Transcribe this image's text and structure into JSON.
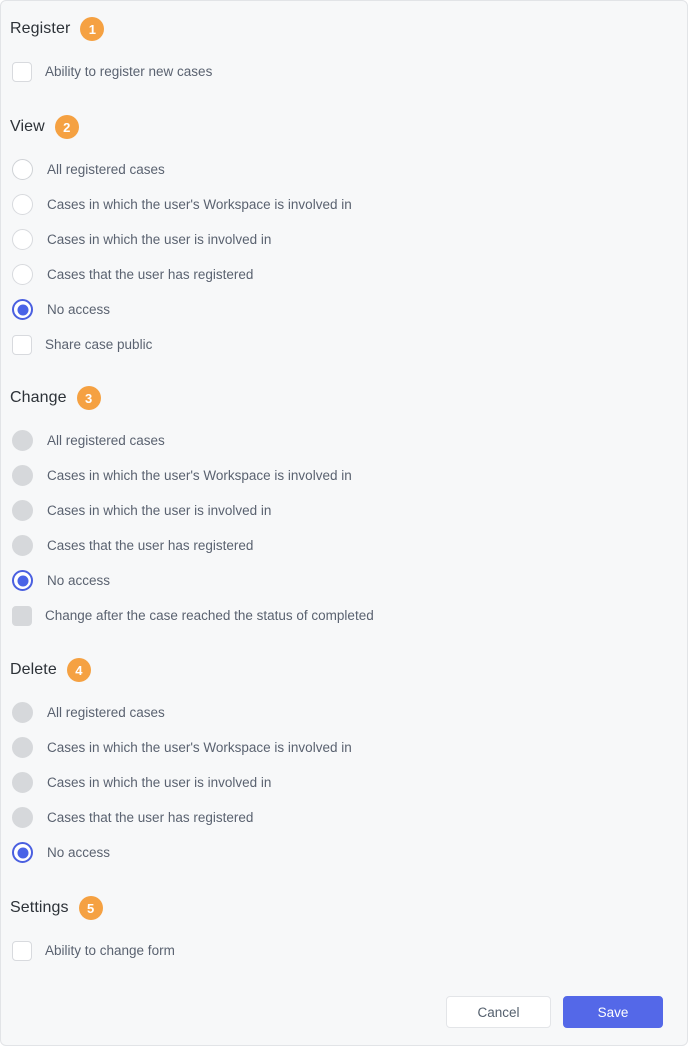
{
  "colors": {
    "card_background": "#f7f8f9",
    "card_border": "#e2e4e7",
    "badge_orange": "#f5a142",
    "accent_blue": "#5468e8",
    "radio_selected_blue": "#4a63e7",
    "disabled_gray": "#d6d8db",
    "heading_text": "#2d3238",
    "label_text": "#5a6270"
  },
  "sections": [
    {
      "key": "register",
      "title": "Register",
      "badge": "1",
      "options": [
        {
          "type": "checkbox",
          "label": "Ability to register new cases",
          "state": "unchecked",
          "name": "checkbox-ability-to-register-new-cases"
        }
      ]
    },
    {
      "key": "view",
      "title": "View",
      "badge": "2",
      "options": [
        {
          "type": "radio",
          "label": "All registered cases",
          "state": "unselected",
          "name": "radio-view-all-registered-cases"
        },
        {
          "type": "radio",
          "label": "Cases in which the user's Workspace is involved in",
          "state": "unselected",
          "name": "radio-view-workspace-involved"
        },
        {
          "type": "radio",
          "label": "Cases in which the user is involved in",
          "state": "unselected",
          "name": "radio-view-user-involved"
        },
        {
          "type": "radio",
          "label": "Cases that the user has registered",
          "state": "unselected",
          "name": "radio-view-user-registered"
        },
        {
          "type": "radio",
          "label": "No access",
          "state": "selected",
          "name": "radio-view-no-access"
        },
        {
          "type": "checkbox",
          "label": "Share case public",
          "state": "unchecked",
          "name": "checkbox-share-case-public"
        }
      ]
    },
    {
      "key": "change",
      "title": "Change",
      "badge": "3",
      "options": [
        {
          "type": "radio",
          "label": "All registered cases",
          "state": "disabled",
          "name": "radio-change-all-registered-cases"
        },
        {
          "type": "radio",
          "label": "Cases in which the user's Workspace is involved in",
          "state": "disabled",
          "name": "radio-change-workspace-involved"
        },
        {
          "type": "radio",
          "label": "Cases in which the user is involved in",
          "state": "disabled",
          "name": "radio-change-user-involved"
        },
        {
          "type": "radio",
          "label": "Cases that the user has registered",
          "state": "disabled",
          "name": "radio-change-user-registered"
        },
        {
          "type": "radio",
          "label": "No access",
          "state": "selected",
          "name": "radio-change-no-access"
        },
        {
          "type": "checkbox",
          "label": "Change after the case reached the status of completed",
          "state": "disabled",
          "name": "checkbox-change-after-completed"
        }
      ]
    },
    {
      "key": "delete",
      "title": "Delete",
      "badge": "4",
      "options": [
        {
          "type": "radio",
          "label": "All registered cases",
          "state": "disabled",
          "name": "radio-delete-all-registered-cases"
        },
        {
          "type": "radio",
          "label": "Cases in which the user's Workspace is involved in",
          "state": "disabled",
          "name": "radio-delete-workspace-involved"
        },
        {
          "type": "radio",
          "label": "Cases in which the user is involved in",
          "state": "disabled",
          "name": "radio-delete-user-involved"
        },
        {
          "type": "radio",
          "label": "Cases that the user has registered",
          "state": "disabled",
          "name": "radio-delete-user-registered"
        },
        {
          "type": "radio",
          "label": "No access",
          "state": "selected",
          "name": "radio-delete-no-access"
        }
      ]
    },
    {
      "key": "settings",
      "title": "Settings",
      "badge": "5",
      "options": [
        {
          "type": "checkbox",
          "label": "Ability to change form",
          "state": "unchecked",
          "name": "checkbox-ability-to-change-form"
        }
      ]
    }
  ],
  "footer": {
    "cancel_label": "Cancel",
    "save_label": "Save"
  }
}
